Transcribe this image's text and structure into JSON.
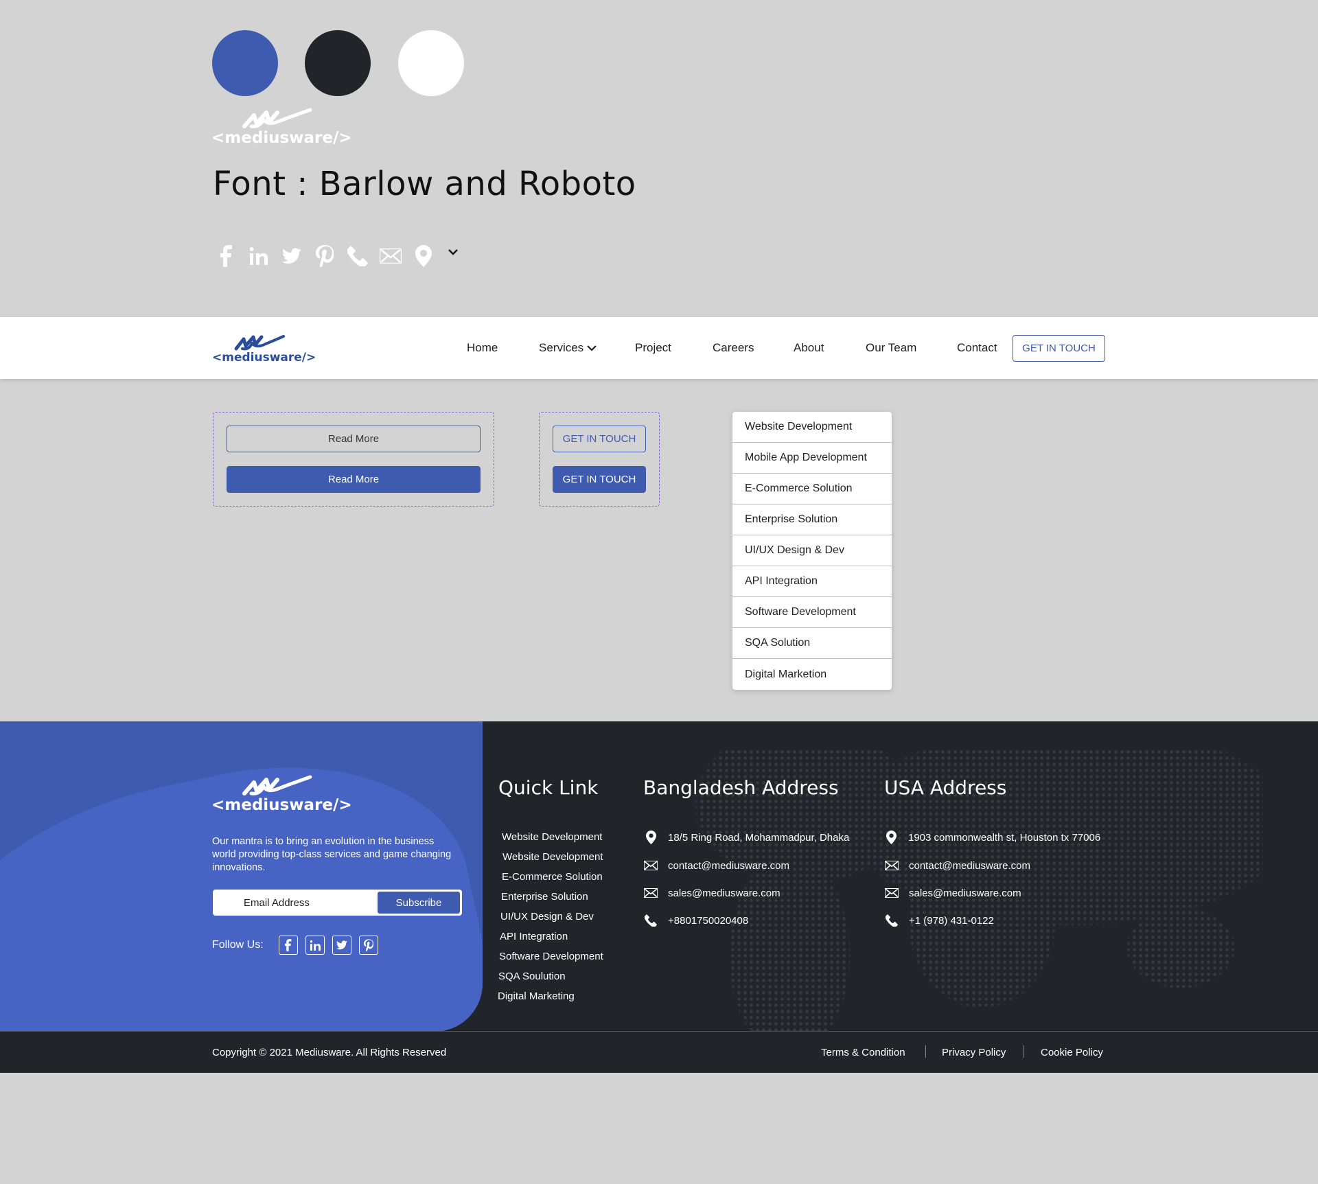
{
  "colors": {
    "primary": "#3e5bb0",
    "dark": "#212529",
    "white": "#ffffff",
    "accent_teal": "#1aa5b8"
  },
  "brand": {
    "logo_text": "<mediusware/>"
  },
  "font_title": "Font : Barlow and Roboto",
  "icons_row": [
    "facebook-icon",
    "linkedin-icon",
    "twitter-icon",
    "pinterest-icon",
    "phone-icon",
    "mail-icon",
    "location-icon",
    "chevron-down-icon"
  ],
  "nav": {
    "items": [
      "Home",
      "Services",
      "Project",
      "Careers",
      "About",
      "Our Team",
      "Contact"
    ],
    "cta": "GET IN TOUCH"
  },
  "buttons": {
    "read_more_outline": "Read More",
    "read_more_filled": "Read More",
    "get_in_touch_outline": "GET IN TOUCH",
    "get_in_touch_filled": "GET IN TOUCH"
  },
  "services_dropdown": [
    "Website Development",
    "Mobile App Development",
    "E-Commerce Solution",
    "Enterprise Solution",
    "UI/UX Design & Dev",
    "API Integration",
    "Software Development",
    "SQA Solution",
    "Digital Marketion"
  ],
  "footer": {
    "mantra": "Our mantra is to bring an evolution in the business world providing top-class services and game changing innovations.",
    "email_placeholder": "Email Address",
    "subscribe": "Subscribe",
    "follow_us": "Follow Us:",
    "quick_link_title": "Quick Link",
    "quick_links": [
      "Website Development",
      "Website Development",
      "E-Commerce Solution",
      "Enterprise Solution",
      "UI/UX Design & Dev",
      "API Integration",
      "Software Development",
      "SQA Soulution",
      "Digital Marketing"
    ],
    "bd_title": "Bangladesh Address",
    "bd": {
      "address": "18/5 Ring Road, Mohammadpur, Dhaka",
      "email1": "contact@mediusware.com",
      "email2": "sales@mediusware.com",
      "phone": "+8801750020408"
    },
    "usa_title": "USA Address",
    "usa": {
      "address": "1903 commonwealth st, Houston tx 77006",
      "email1": "contact@mediusware.com",
      "email2": "sales@mediusware.com",
      "phone": "+1 (978) 431-0122"
    }
  },
  "copyright": "Copyright © 2021 Mediusware. All Rights Reserved",
  "legal": [
    "Terms & Condition",
    "Privacy Policy",
    "Cookie Policy"
  ]
}
